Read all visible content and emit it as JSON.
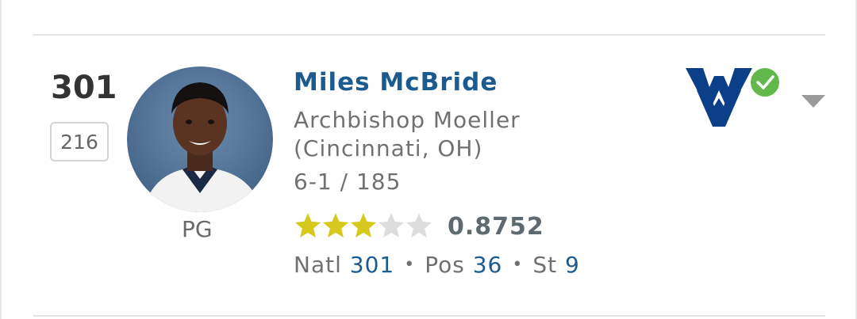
{
  "player": {
    "rank": "301",
    "previous_rank": "216",
    "name": "Miles McBride",
    "school": "Archbishop Moeller (Cincinnati, OH)",
    "height_weight": "6-1 / 185",
    "position": "PG",
    "stars_filled": 3,
    "stars_total": 5,
    "rating": "0.8752",
    "rankings": {
      "natl_label": "Natl",
      "natl_value": "301",
      "pos_label": "Pos",
      "pos_value": "36",
      "st_label": "St",
      "st_value": "9",
      "separator": "•"
    }
  },
  "commitment": {
    "school_logo": "west-virginia-logo",
    "status_icon": "checkmark-icon",
    "committed": true
  },
  "colors": {
    "name_link": "#1c5b8f",
    "star_filled": "#d6c81c",
    "star_empty": "#dddddd",
    "logo_navy": "#0b3f87",
    "check_green": "#62b84a"
  },
  "icons": {
    "dropdown": "chevron-down-icon"
  }
}
